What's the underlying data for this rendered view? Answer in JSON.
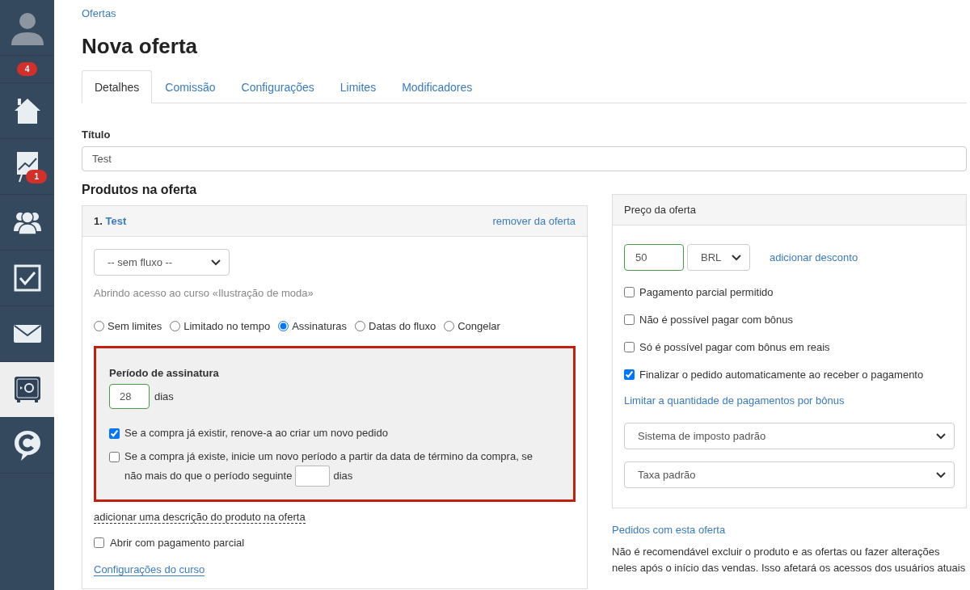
{
  "sidebar": {
    "items": [
      {
        "kind": "avatar",
        "selected": false
      },
      {
        "kind": "notifications",
        "badge": "4",
        "selected": false
      },
      {
        "kind": "home",
        "selected": false
      },
      {
        "kind": "chart",
        "badge": "1",
        "selected": false
      },
      {
        "kind": "people",
        "selected": false
      },
      {
        "kind": "tasks",
        "selected": false
      },
      {
        "kind": "mail",
        "selected": false
      },
      {
        "kind": "safe",
        "selected": true
      },
      {
        "kind": "chat",
        "selected": false
      }
    ]
  },
  "breadcrumb": "Ofertas",
  "title": "Nova oferta",
  "tabs": [
    {
      "label": "Detalhes",
      "selected": true
    },
    {
      "label": "Comissão",
      "selected": false
    },
    {
      "label": "Configurações",
      "selected": false
    },
    {
      "label": "Limites",
      "selected": false
    },
    {
      "label": "Modificadores",
      "selected": false
    }
  ],
  "title_field": {
    "label": "Título",
    "value": "Test"
  },
  "products": {
    "heading": "Produtos na oferta",
    "product": {
      "number": "1.",
      "name": "Test",
      "remove_link": "remover da oferta",
      "flow_select": "-- sem fluxo --",
      "access_note": "Abrindo acesso ao curso «Ilustração de moda»",
      "access_types": [
        {
          "label": "Sem limites",
          "selected": false
        },
        {
          "label": "Limitado no tempo",
          "selected": false
        },
        {
          "label": "Assinaturas",
          "selected": true
        },
        {
          "label": "Datas do fluxo",
          "selected": false
        },
        {
          "label": "Congelar",
          "selected": false
        }
      ],
      "subscription": {
        "label": "Período de assinatura",
        "value": "28",
        "unit": "dias",
        "options": [
          {
            "kind": "plain",
            "label": "Se a compra já existir, renove-a ao criar um novo pedido",
            "checked": true
          },
          {
            "kind": "with_days",
            "label_lines": [
              "Se a compra já existe, inicie um novo período a partir da data de término da compra, se",
              "não mais do que o período seguinte"
            ],
            "unit": "dias",
            "checked": false
          }
        ]
      },
      "description_link": "adicionar uma descrição do produto na oferta",
      "partial_payment": {
        "label": "Abrir com pagamento parcial",
        "checked": false
      },
      "course_settings_link": "Configurações do curso"
    }
  },
  "price_panel": {
    "title": "Preço da oferta",
    "amount": "50",
    "currency": "BRL",
    "discount_link": "adicionar desconto",
    "options": [
      {
        "label": "Pagamento parcial permitido",
        "checked": false
      },
      {
        "label": "Não é possível pagar com bônus",
        "checked": false
      },
      {
        "label": "Só é possível pagar com bônus em reais",
        "checked": false
      },
      {
        "label": "Finalizar o pedido automaticamente ao receber o pagamento",
        "checked": true
      }
    ],
    "bonus_limit_link": "Limitar a quantidade de pagamentos por bônus",
    "tax_system": "Sistema de imposto padrão",
    "tax_rate": "Taxa padrão"
  },
  "orders_link": "Pedidos com esta oferta",
  "warning": "Não é recomendável excluir o produto e as ofertas ou fazer alterações neles após o início das vendas. Isso afetará os acessos dos usuários atuais"
}
